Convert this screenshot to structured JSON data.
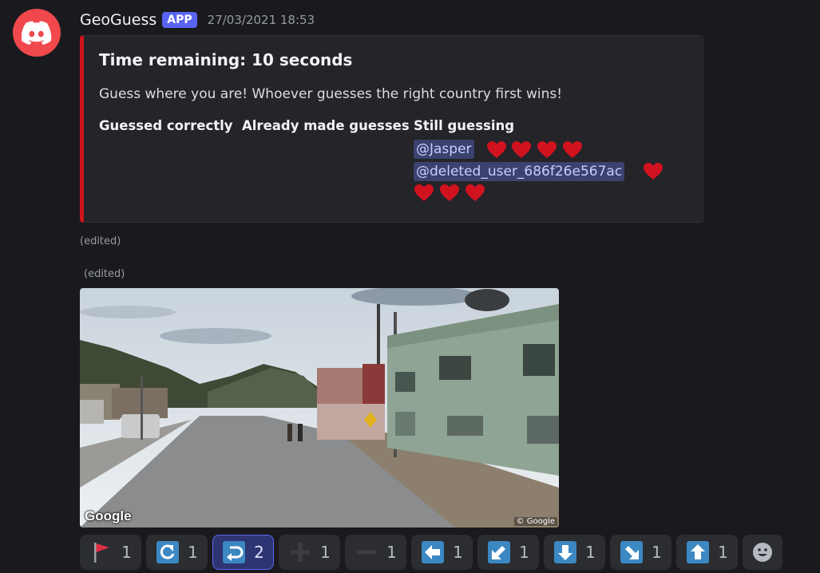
{
  "message": {
    "author": "GeoGuess",
    "badge": "APP",
    "timestamp": "27/03/2021 18:53"
  },
  "embed": {
    "accent_color": "#d0141d",
    "title": "Time remaining: 10 seconds",
    "description": "Guess where you are! Whoever guesses the right country first wins!",
    "fields": [
      {
        "name": "Guessed correctly"
      },
      {
        "name": "Already made guesses"
      },
      {
        "name": "Still guessing"
      }
    ],
    "still_guessing": [
      {
        "mention": "@Jasper",
        "hearts": 4
      },
      {
        "mention": "@deleted_user_686f26e567ac",
        "hearts": 4
      }
    ]
  },
  "edited_label_1": "(edited)",
  "edited_label_2": "(edited)",
  "image": {
    "description_icon": "street-view-photo",
    "logo_text": "Google",
    "copyright": "© Google"
  },
  "reactions": [
    {
      "icon": "red-flag-icon",
      "count": "1",
      "active": false
    },
    {
      "icon": "arrow-clockwise-icon",
      "count": "1",
      "active": false
    },
    {
      "icon": "arrow-return-icon",
      "count": "2",
      "active": true
    },
    {
      "icon": "plus-icon",
      "count": "1",
      "active": false
    },
    {
      "icon": "minus-icon",
      "count": "1",
      "active": false
    },
    {
      "icon": "arrow-left-icon",
      "count": "1",
      "active": false
    },
    {
      "icon": "arrow-down-left-icon",
      "count": "1",
      "active": false
    },
    {
      "icon": "arrow-down-icon",
      "count": "1",
      "active": false
    },
    {
      "icon": "arrow-down-right-icon",
      "count": "1",
      "active": false
    },
    {
      "icon": "arrow-up-icon",
      "count": "1",
      "active": false
    }
  ],
  "colors": {
    "brand": "#5865f2",
    "avatar": "#f0484c",
    "mention_bg": "#3c4270",
    "heart": "#d1121f"
  }
}
